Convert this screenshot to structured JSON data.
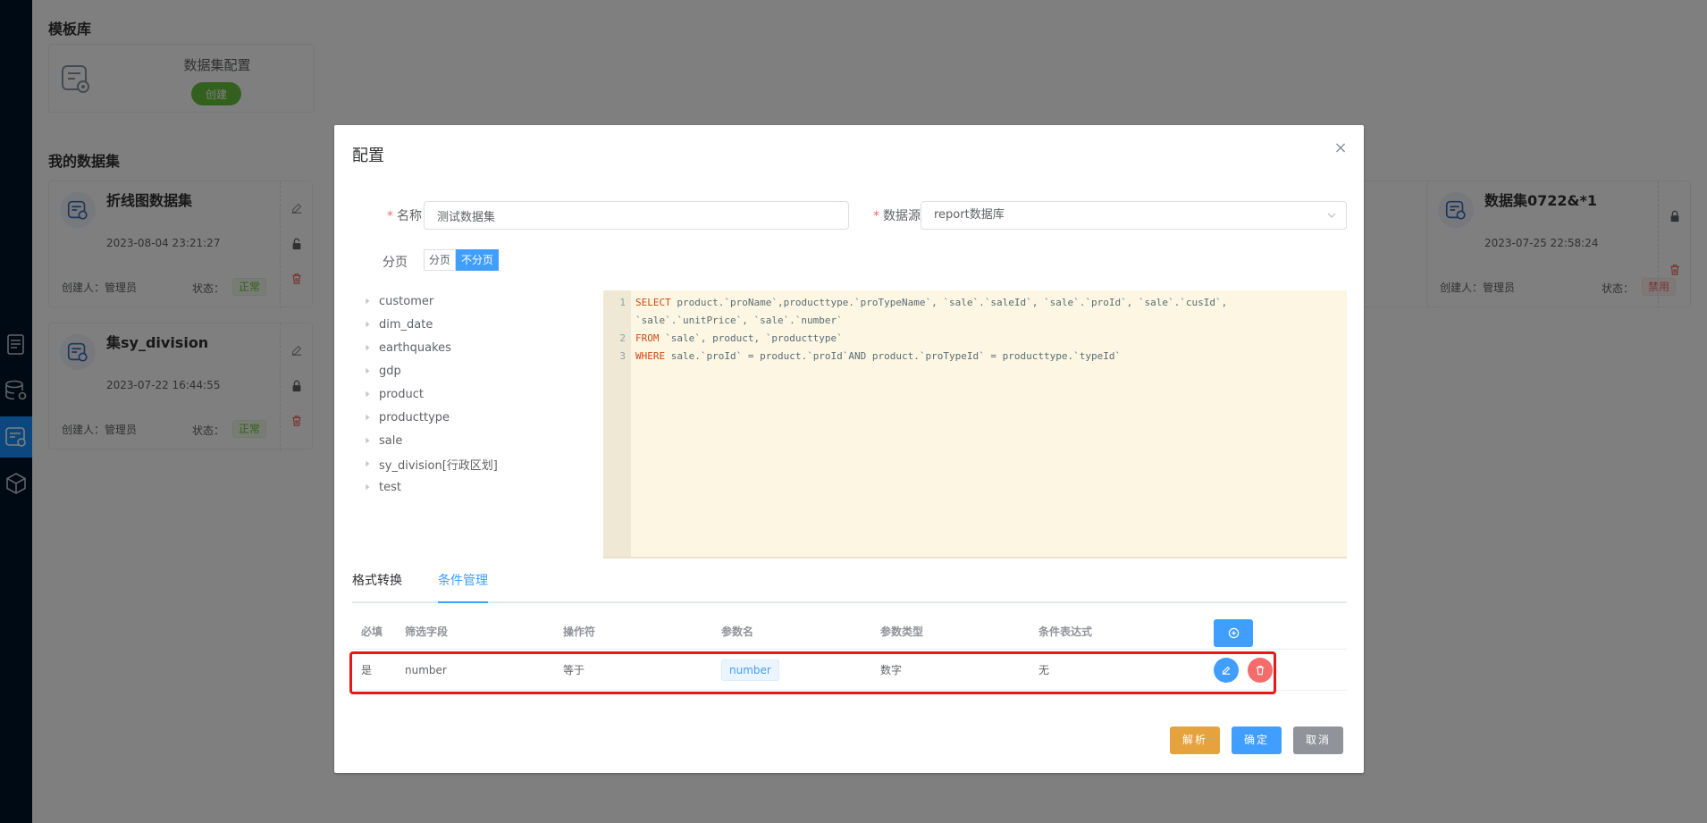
{
  "page": {
    "template_section_title": "模板库",
    "my_datasets_title": "我的数据集"
  },
  "template_card": {
    "name": "数据集配置",
    "create_label": "创建"
  },
  "datasets": [
    {
      "title": "折线图数据集",
      "date": "2023-08-04 23:21:27",
      "creator": "创建人：管理员",
      "status_label": "状态：",
      "status": "正常",
      "lock": "unlocked"
    },
    {
      "title": "集sy_division",
      "date": "2023-07-22 16:44:55",
      "creator": "创建人：管理员",
      "status_label": "状态：",
      "status": "正常",
      "lock": "locked"
    },
    {
      "title": "数据集0722&*1",
      "date": "2023-07-25 22:58:24",
      "creator": "创建人：管理员",
      "status_label": "状态：",
      "status": "禁用",
      "lock": "locked"
    }
  ],
  "dialog": {
    "title": "配置",
    "close_symbol": "×",
    "name_label": "名称",
    "name_value": "测试数据集",
    "source_label": "数据源",
    "source_value": "report数据库",
    "paging_label": "分页",
    "paging_options": [
      "分页",
      "不分页"
    ],
    "paging_selected": "不分页",
    "tables": [
      "customer",
      "dim_date",
      "earthquakes",
      "gdp",
      "product",
      "producttype",
      "sale",
      "sy_division[行政区划]",
      "test"
    ],
    "sql_lines": [
      {
        "num": "1",
        "kw": "SELECT",
        "text": " product.`proName`,producttype.`proTypeName`, `sale`.`saleId`, `sale`.`proId`, `sale`.`cusId`,"
      },
      {
        "num": "",
        "kw": "",
        "text": "`sale`.`unitPrice`, `sale`.`number`"
      },
      {
        "num": "2",
        "kw": "FROM",
        "text": " `sale`, product, `producttype`"
      },
      {
        "num": "3",
        "kw": "WHERE",
        "text": " sale.`proId` = product.`proId`AND product.`proTypeId` = producttype.`typeId`"
      }
    ],
    "tabs": [
      "格式转换",
      "条件管理"
    ],
    "active_tab": "条件管理",
    "table_headers": [
      "必填",
      "筛选字段",
      "操作符",
      "参数名",
      "参数类型",
      "条件表达式"
    ],
    "condition_rows": [
      {
        "required": "是",
        "field": "number",
        "operator": "等于",
        "param": "number",
        "param_type": "数字",
        "expression": "无"
      }
    ],
    "buttons": {
      "parse": "解析",
      "confirm": "确定",
      "cancel": "取消"
    }
  },
  "colors": {
    "primary": "#409eff",
    "success": "#67c23a",
    "warning": "#e6a23c",
    "danger": "#f56c6c",
    "info": "#909399",
    "highlight": "#e81818"
  }
}
